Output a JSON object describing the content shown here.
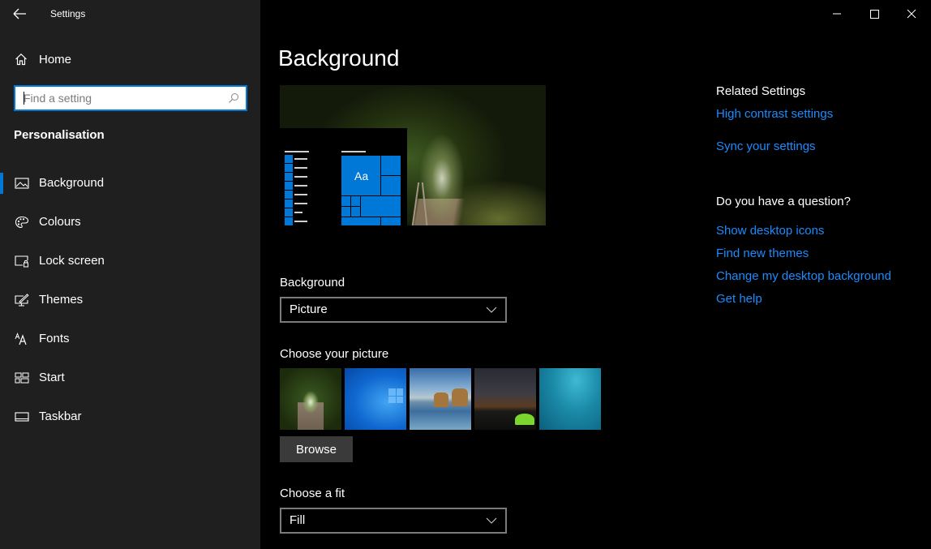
{
  "window": {
    "title": "Settings",
    "controls": {
      "minimize": "minimize-icon",
      "maximize": "maximize-icon",
      "close": "close-icon"
    }
  },
  "sidebar": {
    "home_label": "Home",
    "search": {
      "placeholder": "Find a setting",
      "value": ""
    },
    "section_title": "Personalisation",
    "items": [
      {
        "label": "Background",
        "icon": "picture-icon",
        "active": true
      },
      {
        "label": "Colours",
        "icon": "palette-icon",
        "active": false
      },
      {
        "label": "Lock screen",
        "icon": "lock-screen-icon",
        "active": false
      },
      {
        "label": "Themes",
        "icon": "themes-icon",
        "active": false
      },
      {
        "label": "Fonts",
        "icon": "fonts-icon",
        "active": false
      },
      {
        "label": "Start",
        "icon": "start-icon",
        "active": false
      },
      {
        "label": "Taskbar",
        "icon": "taskbar-icon",
        "active": false
      }
    ]
  },
  "main": {
    "page_title": "Background",
    "preview": {
      "tile_text": "Aa"
    },
    "background_label": "Background",
    "background_value": "Picture",
    "choose_picture_label": "Choose your picture",
    "pictures": [
      "Tree tunnel railway",
      "Windows blue",
      "Beach rocks",
      "Milky way tent",
      "Underwater swimmer"
    ],
    "browse_label": "Browse",
    "fit_label": "Choose a fit",
    "fit_value": "Fill"
  },
  "related": {
    "heading": "Related Settings",
    "links": [
      "High contrast settings",
      "Sync your settings"
    ],
    "question_heading": "Do you have a question?",
    "help_links": [
      "Show desktop icons",
      "Find new themes",
      "Change my desktop background",
      "Get help"
    ]
  },
  "colors": {
    "accent": "#0078d7",
    "link": "#1a8cff",
    "sidebar_bg": "#1f1f1f",
    "main_bg": "#000000"
  }
}
